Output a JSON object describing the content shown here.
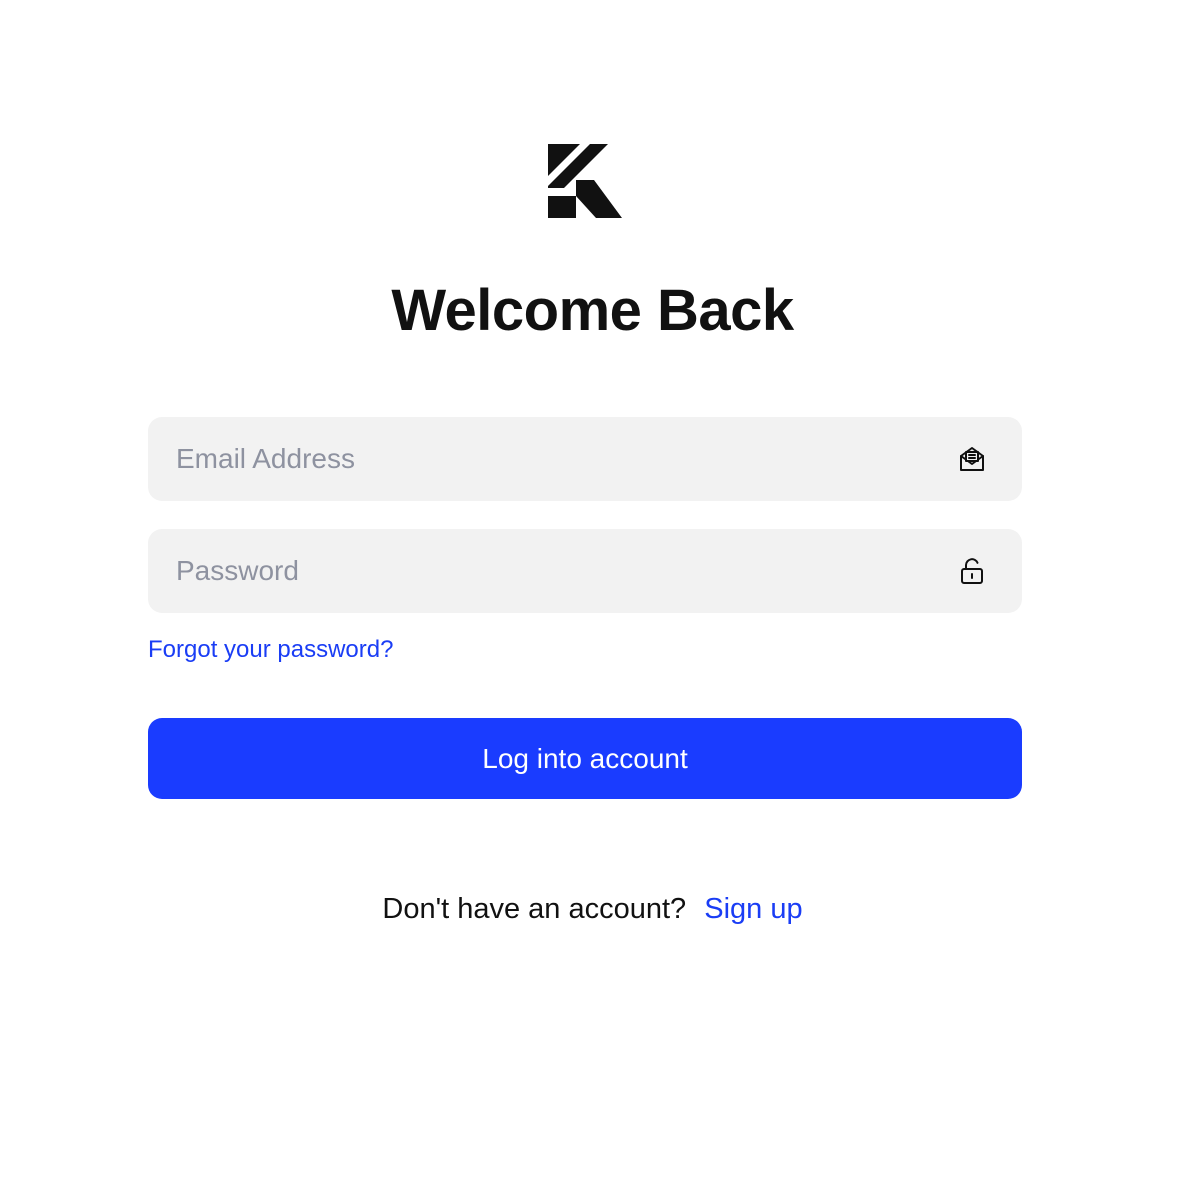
{
  "logo": {
    "icon": "k-logo-icon"
  },
  "page": {
    "title": "Welcome Back"
  },
  "form": {
    "email": {
      "placeholder": "Email Address",
      "value": "",
      "icon": "mail-icon"
    },
    "password": {
      "placeholder": "Password",
      "value": "",
      "icon": "unlock-icon"
    },
    "forgot_link": "Forgot your password?",
    "submit_label": "Log into account"
  },
  "signup": {
    "prompt": "Don't have an account?",
    "link": "Sign up"
  },
  "colors": {
    "accent": "#1a3cff",
    "link": "#1a3df5",
    "field_bg": "#f2f2f2",
    "placeholder": "#8e92a0",
    "text": "#111111"
  }
}
